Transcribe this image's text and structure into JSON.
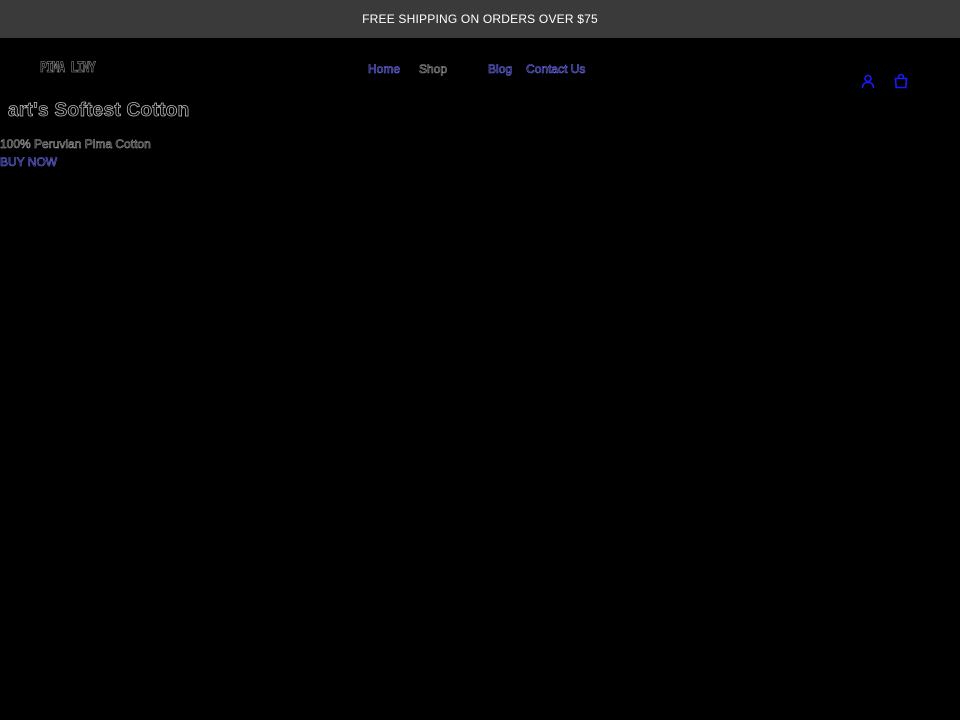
{
  "announcement": {
    "text": "FREE SHIPPING ON ORDERS OVER $75"
  },
  "header": {
    "logo_text": "PIMA LINY",
    "nav": [
      {
        "label": "Home"
      },
      {
        "label": "Shop"
      },
      {
        "label": "Blog"
      },
      {
        "label": "Contact Us"
      }
    ],
    "icons": [
      "account-icon",
      "cart-icon"
    ]
  },
  "hero": {
    "title": "art's Softest Cotton",
    "subtitle": "100% Peruvian Pima Cotton",
    "cta_label": "BUY NOW"
  },
  "colors": {
    "page_background": "#000000",
    "announcement_background": "#3a3a3a",
    "announcement_text": "#ffffff",
    "link_accent": "#6d6df5",
    "icon_accent": "#1a1aff",
    "muted_text": "#9a9a9a"
  }
}
